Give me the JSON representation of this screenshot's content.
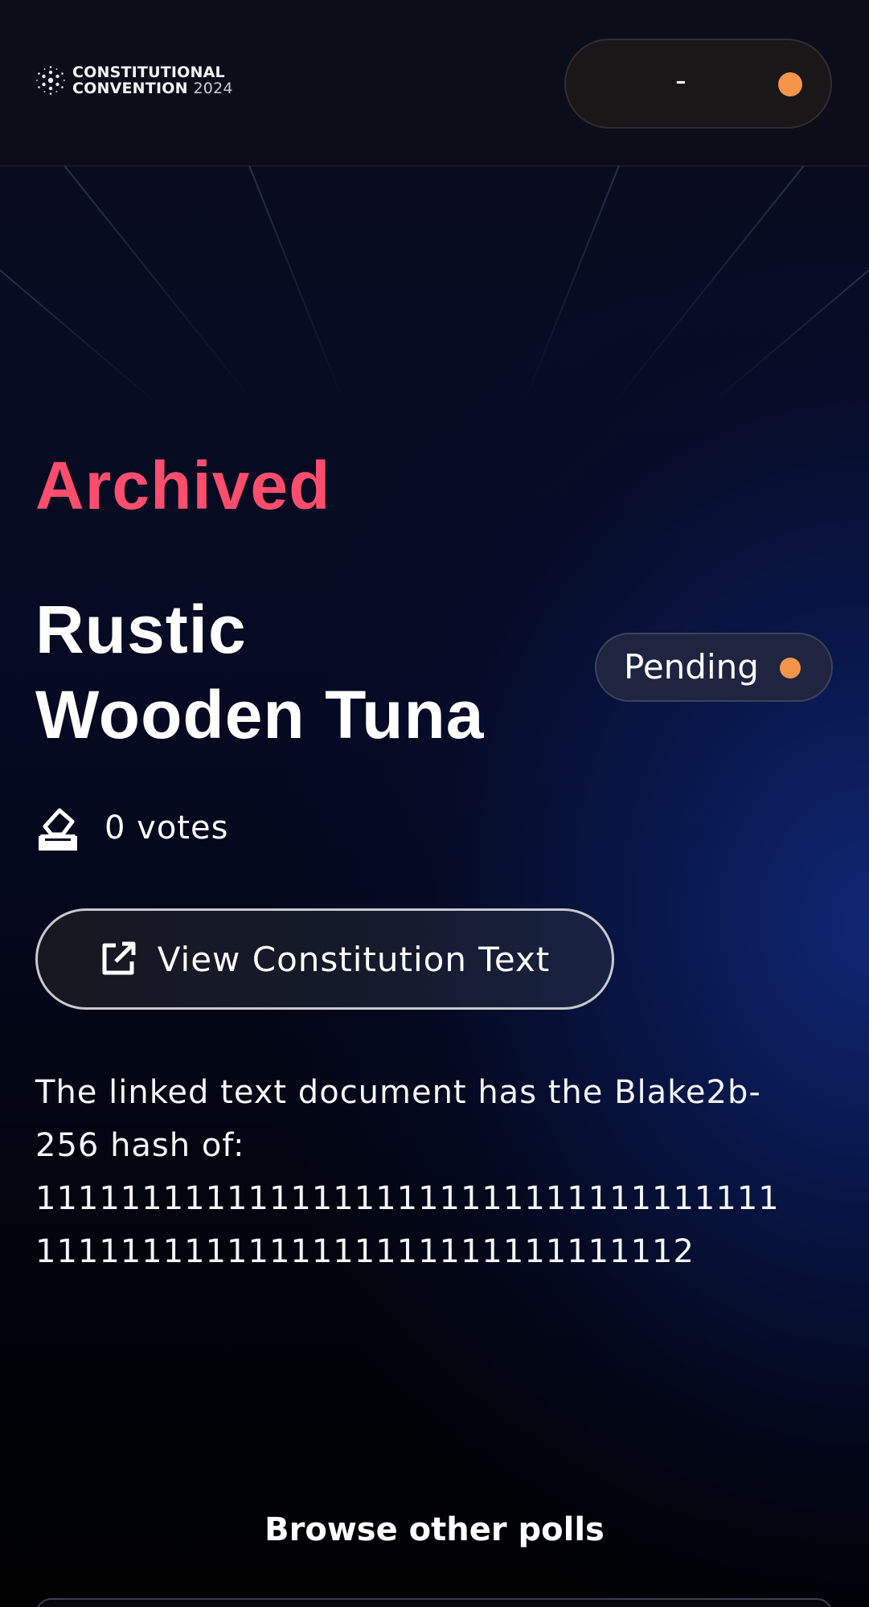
{
  "header": {
    "logo": {
      "line1": "CONSTITUTIONAL",
      "line2": "CONVENTION",
      "year": "2024",
      "icon": "cardano-logo-icon"
    },
    "wallet": {
      "value": "-",
      "status_color": "#f5954a"
    }
  },
  "poll": {
    "status": "Archived",
    "status_color": "#ff4d6d",
    "title_line1": "Rustic",
    "title_line2": "Wooden Tuna",
    "badge": {
      "label": "Pending",
      "dot_color": "#f5954a"
    },
    "votes": {
      "icon": "ballot-box-icon",
      "label": "0 votes"
    },
    "constitution_button": {
      "icon": "external-link-icon",
      "label": "View Constitution Text"
    },
    "hash": {
      "line1": "The linked text document has the Blake2b-",
      "line2": "256 hash of:",
      "line3": "11111111111111111111111111111111111",
      "line4": "1111111111111111111111111111112"
    }
  },
  "footer": {
    "browse_label": "Browse other polls"
  }
}
